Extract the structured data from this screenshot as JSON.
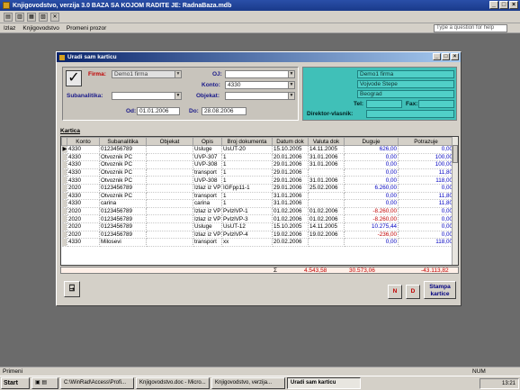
{
  "app": {
    "title": "Knjigovodstvo, verzija 3.0      BAZA SA KOJOM RADITE JE: RadnaBaza.mdb"
  },
  "menu": {
    "items": [
      "Izlaz",
      "Knjigovodstvo",
      "Promeni prozor"
    ],
    "help_placeholder": "Type a question for help"
  },
  "form": {
    "title": "Uradi sam karticu",
    "firma_label": "Firma:",
    "firma_value": "Demo1 firma",
    "oj_label": "OJ:",
    "oj_value": "",
    "konto_label": "Konto:",
    "konto_value": "4330",
    "subanalitika_label": "Subanalitika:",
    "subanalitika_value": "",
    "objekat_label": "Objekat:",
    "objekat_value": "",
    "od_label": "Od:",
    "od_value": "01.01.2006",
    "do_label": "Do:",
    "do_value": "28.08.2006",
    "company": {
      "name": "Demo1 firma",
      "street": "Vojvode Stepe",
      "city": "Beograd",
      "tel_label": "Tel:",
      "fax_label": "Fax:",
      "director_label": "Direktor-vlasnik:"
    },
    "kartica_label": "Kartica",
    "columns": [
      "Konto",
      "Subanalitika",
      "Objekat",
      "Opis",
      "Broj dokumenta",
      "Datum dok",
      "Valuta dok",
      "Duguje",
      "Potrazuje"
    ],
    "rows": [
      {
        "konto": "4330",
        "sub": "0123456789",
        "obj": "",
        "opis": "Usluge",
        "broj": "UsUT-20",
        "datum": "15.10.2005",
        "valuta": "14.11.2005",
        "duguje": "626,00",
        "potrazuje": "0,00",
        "dug_neg": false
      },
      {
        "konto": "4330",
        "sub": "Otvoznik PC",
        "obj": "",
        "opis": "UVP-307",
        "broj": "1",
        "datum": "20.01.2006",
        "valuta": "31.01.2006",
        "duguje": "0,00",
        "potrazuje": "100,00",
        "dug_neg": false
      },
      {
        "konto": "4330",
        "sub": "Otvoznik PC",
        "obj": "",
        "opis": "UVP-308",
        "broj": "1",
        "datum": "29.01.2006",
        "valuta": "31.01.2006",
        "duguje": "0,00",
        "potrazuje": "100,00",
        "dug_neg": false
      },
      {
        "konto": "4330",
        "sub": "Otvoznik PC",
        "obj": "",
        "opis": "transport",
        "broj": "1",
        "datum": "29.01.2006",
        "valuta": "",
        "duguje": "0,00",
        "potrazuje": "11,80",
        "dug_neg": false
      },
      {
        "konto": "4330",
        "sub": "Otvoznik PC",
        "obj": "",
        "opis": "UVP-308",
        "broj": "1",
        "datum": "29.01.2006",
        "valuta": "31.01.2006",
        "duguje": "0,00",
        "potrazuje": "118,00",
        "dug_neg": false
      },
      {
        "konto": "2020",
        "sub": "0123456789",
        "obj": "",
        "opis": "Izlaz iz VP",
        "broj": "IGFpp11-1",
        "datum": "29.01.2006",
        "valuta": "25.02.2006",
        "duguje": "6.260,00",
        "potrazuje": "0,00",
        "dug_neg": false
      },
      {
        "konto": "4330",
        "sub": "Otvoznik PC",
        "obj": "",
        "opis": "transport",
        "broj": "1",
        "datum": "31.01.2006",
        "valuta": "",
        "duguje": "0,00",
        "potrazuje": "11,80",
        "dug_neg": false
      },
      {
        "konto": "4330",
        "sub": "carina",
        "obj": "",
        "opis": "carina",
        "broj": "1",
        "datum": "31.01.2006",
        "valuta": "",
        "duguje": "0,00",
        "potrazuje": "11,80",
        "dug_neg": false
      },
      {
        "konto": "2020",
        "sub": "0123456789",
        "obj": "",
        "opis": "Izlaz iz VP",
        "broj": "PvIzlVP-1",
        "datum": "01.02.2006",
        "valuta": "01.02.2006",
        "duguje": "-8.260,00",
        "potrazuje": "0,00",
        "dug_neg": true
      },
      {
        "konto": "2020",
        "sub": "0123456789",
        "obj": "",
        "opis": "Izlaz iz VP",
        "broj": "PvIzlVP-3",
        "datum": "01.02.2006",
        "valuta": "01.02.2006",
        "duguje": "-8.260,00",
        "potrazuje": "0,00",
        "dug_neg": true
      },
      {
        "konto": "2020",
        "sub": "0123456789",
        "obj": "",
        "opis": "Usluge",
        "broj": "UsUT-12",
        "datum": "15.10.2005",
        "valuta": "14.11.2005",
        "duguje": "10.275,44",
        "potrazuje": "0,00",
        "dug_neg": false
      },
      {
        "konto": "2020",
        "sub": "0123456789",
        "obj": "",
        "opis": "Izlaz iz VP",
        "broj": "PvIzlVP-4",
        "datum": "19.02.2006",
        "valuta": "19.02.2006",
        "duguje": "-236,00",
        "potrazuje": "0,00",
        "dug_neg": true
      },
      {
        "konto": "4330",
        "sub": "Milosevi",
        "obj": "",
        "opis": "transport",
        "broj": "xx",
        "datum": "20.02.2006",
        "valuta": "",
        "duguje": "0,00",
        "potrazuje": "118,00",
        "dug_neg": false
      }
    ],
    "totals": {
      "sigma": "Σ",
      "duguje": "4.543,58",
      "col2": "30.573,06",
      "potrazuje": "-43.113,82"
    },
    "buttons": {
      "n": "N",
      "d": "D",
      "stampa": "Stampa kartice"
    }
  },
  "status": {
    "left": "Primeni",
    "right": "NUM"
  },
  "taskbar": {
    "start": "Start",
    "tasks": [
      "C:\\WinRad\\Access\\Profi...",
      "Knjigovodstvo.doc - Micro...",
      "Knjigovodstvo, verzija...",
      "Uradi sam karticu"
    ],
    "clock": "13:21"
  }
}
